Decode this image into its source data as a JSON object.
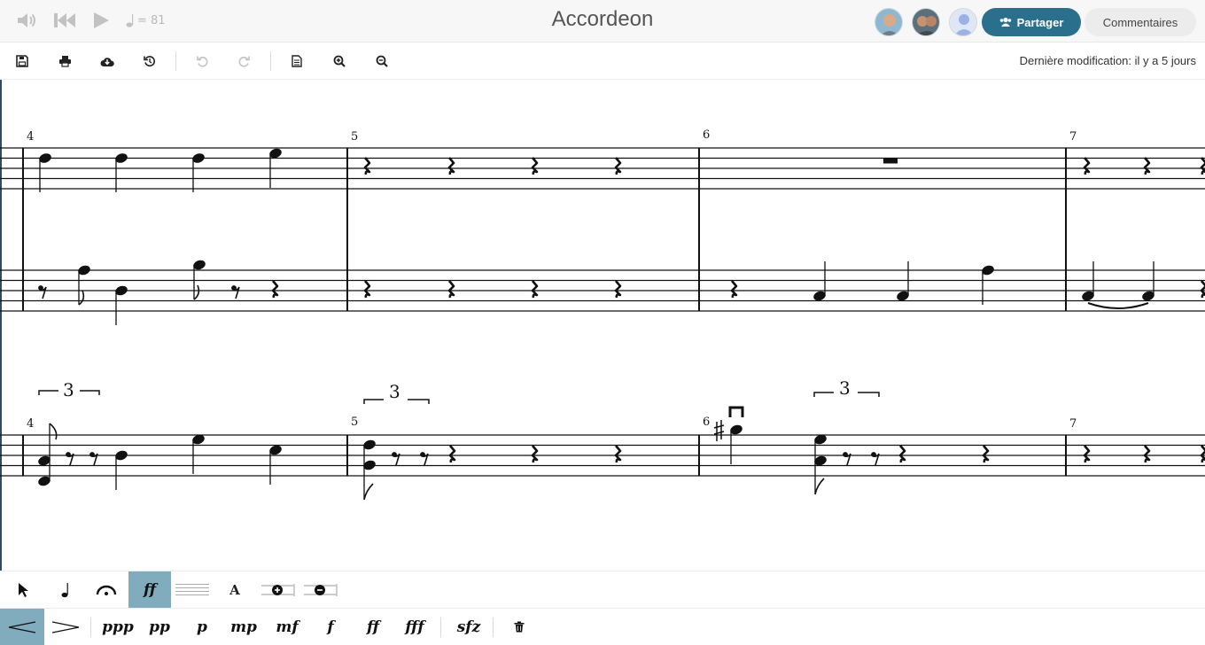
{
  "header": {
    "title": "Accordeon",
    "tempo_label": "= 81",
    "share_label": "Partager",
    "comments_label": "Commentaires"
  },
  "toolbar": {
    "icons": [
      "save-icon",
      "print-icon",
      "cloud-download-icon",
      "history-icon",
      "undo-icon",
      "redo-icon",
      "page-icon",
      "zoom-in-icon",
      "zoom-out-icon"
    ],
    "last_modified": "Dernière modification: il y a 5 jours"
  },
  "score": {
    "system1_measures": [
      "4",
      "5",
      "6",
      "7"
    ],
    "system2_measures": [
      "4",
      "5",
      "6",
      "7"
    ],
    "tuplet_label": "3"
  },
  "palette": {
    "tools": [
      "select-icon",
      "note-icon",
      "fermata-icon",
      "dynamics-icon",
      "staff-lines-icon",
      "text-icon",
      "add-staff-icon",
      "remove-staff-icon"
    ],
    "dynamics_tool_label": "ff",
    "text_tool_label": "A",
    "dynamics": [
      "ppp",
      "pp",
      "p",
      "mp",
      "mf",
      "f",
      "ff",
      "fff",
      "sfz"
    ],
    "accent_color": "#80acbd",
    "share_color": "#2a6f8c"
  }
}
